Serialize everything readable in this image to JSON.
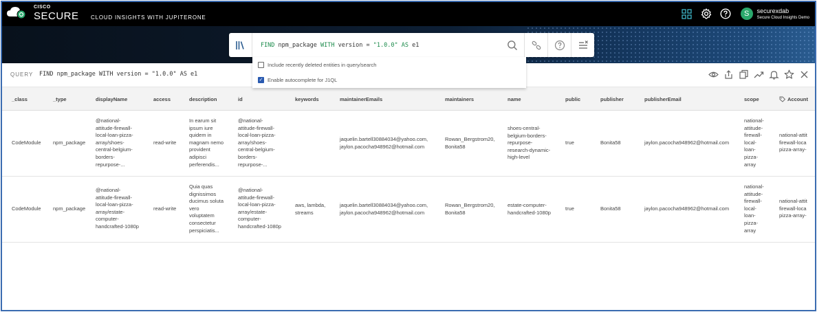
{
  "brand": {
    "cisco": "CISCO",
    "secure": "SECURE",
    "product": "CLOUD INSIGHTS WITH JUPITERONE"
  },
  "navbar": {
    "icons": [
      "grid-icon",
      "gear-icon",
      "help-icon"
    ],
    "user": {
      "initial": "S",
      "name": "securexdab",
      "org": "Secure Cloud Insights Demo"
    }
  },
  "query_bar": {
    "kw_find": "FIND",
    "entity": "npm_package",
    "kw_with": "WITH",
    "prop": "version",
    "op": "=",
    "value": "\"1.0.0\"",
    "kw_as": "AS",
    "alias": "e1"
  },
  "autocomplete": {
    "options": [
      {
        "label": "Include recently deleted entities in query/search",
        "checked": false
      },
      {
        "label": "Enable autocomplete for J1QL",
        "checked": true
      }
    ]
  },
  "query_header": {
    "label": "QUERY",
    "text": "FIND npm_package WITH version = \"1.0.0\" AS e1"
  },
  "table": {
    "columns": [
      "_class",
      "_type",
      "displayName",
      "access",
      "description",
      "id",
      "keywords",
      "maintainerEmails",
      "maintainers",
      "name",
      "public",
      "publisher",
      "publisherEmail",
      "scope",
      "Account"
    ],
    "rows": [
      {
        "_class": "CodeModule",
        "_type": "npm_package",
        "displayName": "@national-\nattitude-firewall-\nlocal-loan-pizza-\narray/shoes-\ncentral-belgium-\nborders-\nrepurpose-...",
        "access": "read-write",
        "description": "In earum sit\nipsum iure\nquidem in\nmagnam nemo\nprovident\nadipisci\nperferendis...",
        "id": "@national-\nattitude-firewall-\nlocal-loan-pizza-\narray/shoes-\ncentral-belgium-\nborders-\nrepurpose-...",
        "keywords": "",
        "maintainerEmails": "jaquelin.bartell30884034@yahoo.com,\njaylon.pacocha948962@hotmail.com",
        "maintainers": "Rowan_Bergstrom20,\nBonita58",
        "name": "shoes-central-\nbelgium-borders-\nrepurpose-\nresearch-dynamic-\nhigh-level",
        "public": "true",
        "publisher": "Bonita58",
        "publisherEmail": "jaylon.pacocha948962@hotmail.com",
        "scope": "national-\nattitude-\nfirewall-\nlocal-\nloan-\npizza-\narray",
        "Account": "national-attit\nfirewall-loca\npizza-array-"
      },
      {
        "_class": "CodeModule",
        "_type": "npm_package",
        "displayName": "@national-\nattitude-firewall-\nlocal-loan-pizza-\narray/estate-\ncomputer-\nhandcrafted-1080p",
        "access": "read-write",
        "description": "Quia quas\ndignissimos\nducimus soluta\nvero\nvoluptatem\nconsectetur\nperspiciatis...",
        "id": "@national-\nattitude-firewall-\nlocal-loan-pizza-\narray/estate-\ncomputer-\nhandcrafted-1080p",
        "keywords": "aws, lambda,\nstreams",
        "maintainerEmails": "jaquelin.bartell30884034@yahoo.com,\njaylon.pacocha948962@hotmail.com",
        "maintainers": "Rowan_Bergstrom20,\nBonita58",
        "name": "estate-computer-\nhandcrafted-1080p",
        "public": "true",
        "publisher": "Bonita58",
        "publisherEmail": "jaylon.pacocha948962@hotmail.com",
        "scope": "national-\nattitude-\nfirewall-\nlocal-\nloan-\npizza-\narray",
        "Account": "national-attit\nfirewall-loca\npizza-array-"
      }
    ]
  },
  "colors": {
    "navbar": "#000000",
    "accent_blue": "#2a5ab0",
    "avatar_green": "#2aa86c",
    "query_keyword": "#1a8a4a"
  }
}
